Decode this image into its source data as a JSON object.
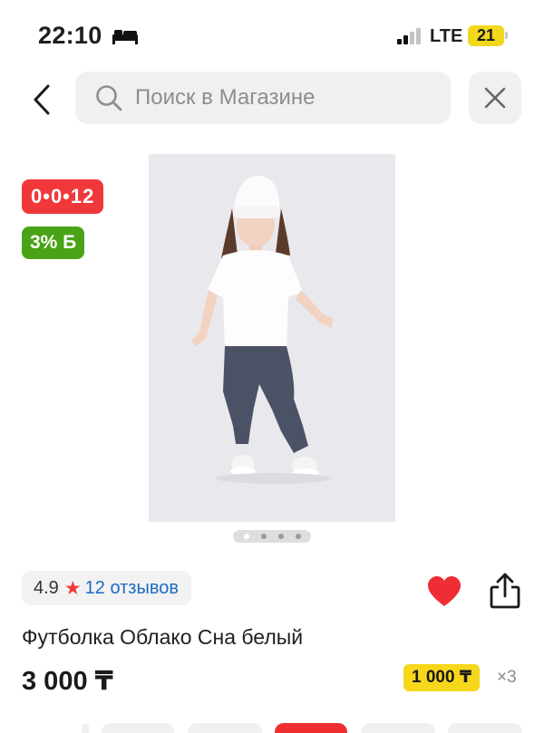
{
  "status_bar": {
    "time": "22:10",
    "network": "LTE",
    "battery": "21"
  },
  "search": {
    "placeholder": "Поиск в Магазине"
  },
  "badges": {
    "installment": "0•0•12",
    "bonus": "3% Б"
  },
  "carousel": {
    "total": 4,
    "active_index": 0
  },
  "rating": {
    "value": "4.9",
    "star": "★",
    "reviews": "12 отзывов"
  },
  "product": {
    "title": "Футболка Облако Сна белый",
    "price": "3 000 ₸",
    "installment_price": "1 000 ₸",
    "installment_multiplier": "×3"
  },
  "icons": {
    "back": "chevron-left-icon",
    "search": "search-icon",
    "close": "close-icon",
    "favorite": "heart-icon",
    "share": "share-icon",
    "bed": "bed-icon",
    "signal": "signal-icon"
  },
  "colors": {
    "red": "#f0383b",
    "green": "#4aa316",
    "yellow": "#f7d71c",
    "link_blue": "#1c6bc4"
  }
}
